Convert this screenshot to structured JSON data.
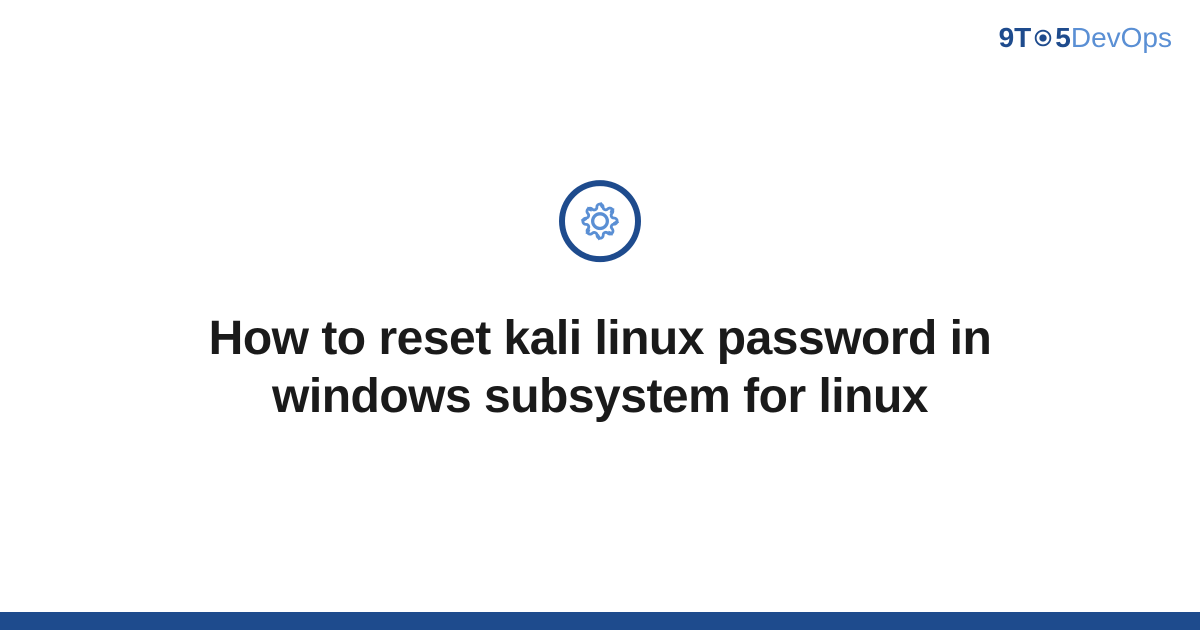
{
  "logo": {
    "part1": "9T",
    "part2": "5",
    "part3": "DevOps",
    "gear_icon": "gear"
  },
  "main": {
    "icon": "gear-icon",
    "title": "How to reset kali linux password in windows subsystem for linux"
  },
  "colors": {
    "brand_dark": "#1e4b8d",
    "brand_light": "#5a8fd4",
    "text": "#1a1a1a"
  }
}
